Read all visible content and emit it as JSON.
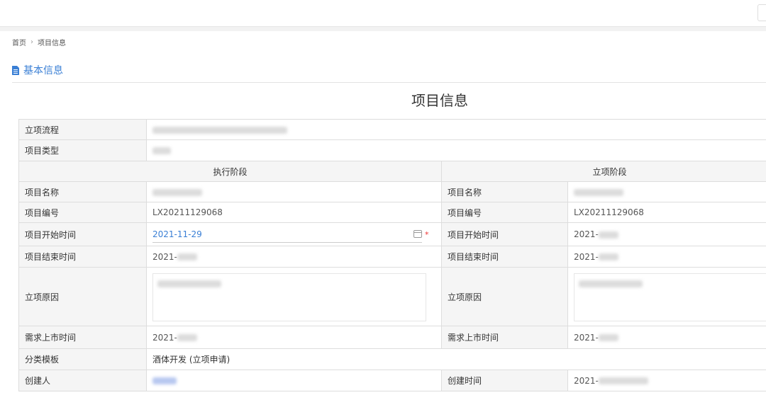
{
  "breadcrumb": {
    "home": "首页",
    "current": "项目信息"
  },
  "section": {
    "title": "基本信息"
  },
  "page": {
    "title": "项目信息"
  },
  "rows": {
    "process_label": "立项流程",
    "type_label": "项目类型",
    "exec_stage": "执行阶段",
    "init_stage": "立项阶段",
    "name_label": "项目名称",
    "code_label": "项目编号",
    "code_value": "LX20211129068",
    "start_label": "项目开始时间",
    "start_exec_value": "2021-11-29",
    "start_init_value": "2021-",
    "end_label": "项目结束时间",
    "end_exec_value": "2021-",
    "end_init_value": "2021-",
    "reason_label": "立项原因",
    "market_label": "需求上市时间",
    "market_exec_value": "2021-",
    "market_init_value": "2021-",
    "category_label": "分类模板",
    "category_value": "酒体开发 (立项申请)",
    "creator_label": "创建人",
    "created_label": "创建时间",
    "created_value": "2021-"
  },
  "colors": {
    "accent": "#3a7fd5",
    "required": "#e33333"
  },
  "icons": {
    "section": "document-icon",
    "date": "calendar-icon",
    "breadcrumb_sep": "chevron-right-icon"
  }
}
